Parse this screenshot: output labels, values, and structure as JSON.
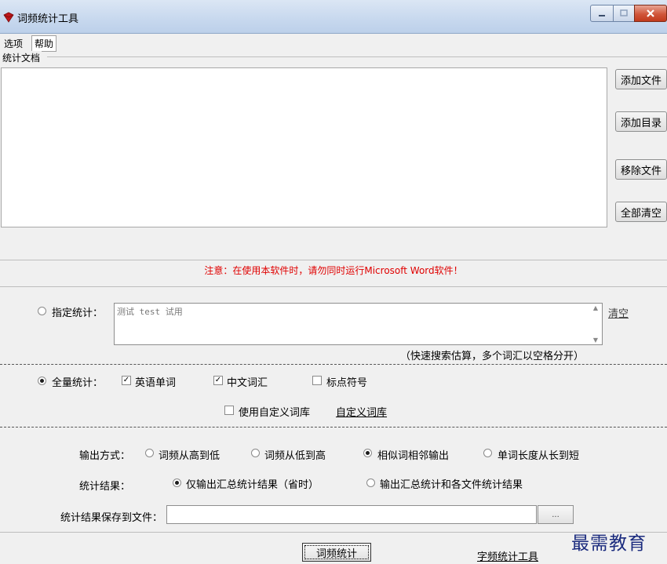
{
  "window": {
    "title": "词频统计工具"
  },
  "menu": {
    "items": [
      "选项",
      "帮助"
    ]
  },
  "docs": {
    "group_label": "统计文档"
  },
  "side_buttons": {
    "add_file": "添加文件",
    "add_dir": "添加目录",
    "remove_file": "移除文件",
    "clear_all": "全部清空"
  },
  "notice": {
    "text": "注意：在使用本软件时，请勿同时运行Microsoft Word软件！"
  },
  "specified": {
    "label": "指定统计：",
    "text": "测试 test 试用",
    "clear_link": "清空",
    "hint": "（快速搜索估算，多个词汇以空格分开）",
    "selected": false
  },
  "full": {
    "label": "全量统计：",
    "selected": true,
    "options": {
      "english": "英语单词",
      "chinese": "中文词汇",
      "punct": "标点符号"
    },
    "checked": {
      "english": true,
      "chinese": true,
      "punct": false
    },
    "custom_lib": "使用自定义词库",
    "custom_lib_checked": false,
    "custom_lib_link": "自定义词库"
  },
  "output": {
    "label": "输出方式：",
    "options": [
      "词频从高到低",
      "词频从低到高",
      "相似词相邻输出",
      "单词长度从长到短"
    ],
    "selected_index": 2
  },
  "result": {
    "label": "统计结果：",
    "options": [
      "仅输出汇总统计结果（省时）",
      "输出汇总统计和各文件统计结果"
    ],
    "selected_index": 0
  },
  "save": {
    "label": "统计结果保存到文件：",
    "value": "",
    "browse": "..."
  },
  "footer": {
    "run_button": "词频统计",
    "char_tool_link": "字频统计工具"
  },
  "watermark": {
    "text": "最需教育"
  }
}
